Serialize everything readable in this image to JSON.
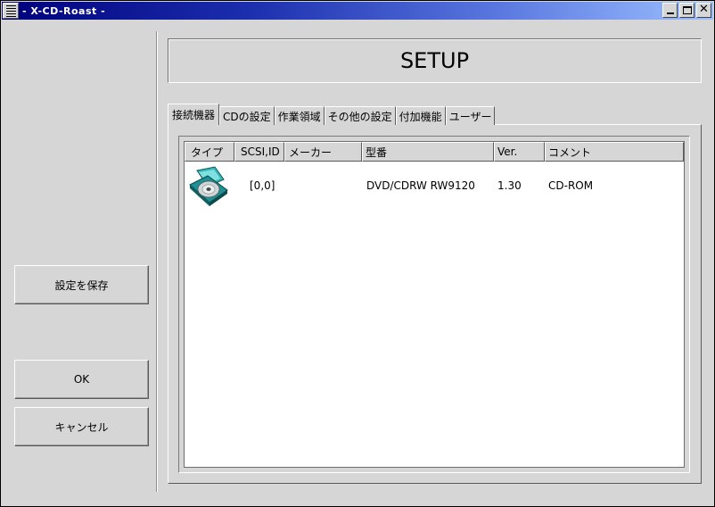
{
  "window": {
    "title": "- X-CD-Roast -"
  },
  "sidebar": {
    "save_label": "設定を保存",
    "ok_label": "OK",
    "cancel_label": "キャンセル"
  },
  "header": {
    "title": "SETUP"
  },
  "tabs": [
    {
      "label": "接続機器",
      "active": true
    },
    {
      "label": "CDの設定",
      "active": false
    },
    {
      "label": "作業領域",
      "active": false
    },
    {
      "label": "その他の設定",
      "active": false
    },
    {
      "label": "付加機能",
      "active": false
    },
    {
      "label": "ユーザー",
      "active": false
    }
  ],
  "device_list": {
    "columns": [
      "タイプ",
      "SCSI,ID",
      "メーカー",
      "型番",
      "Ver.",
      "コメント"
    ],
    "rows": [
      {
        "type_icon": "cdrom-drive-icon",
        "scsi_id": "[0,0]",
        "vendor": "",
        "model": "DVD/CDRW RW9120",
        "version": "1.30",
        "comment": "CD-ROM"
      }
    ]
  },
  "colors": {
    "titlebar_start": "#00007b",
    "titlebar_end": "#9cc0ff",
    "background": "#d6d6d6"
  }
}
